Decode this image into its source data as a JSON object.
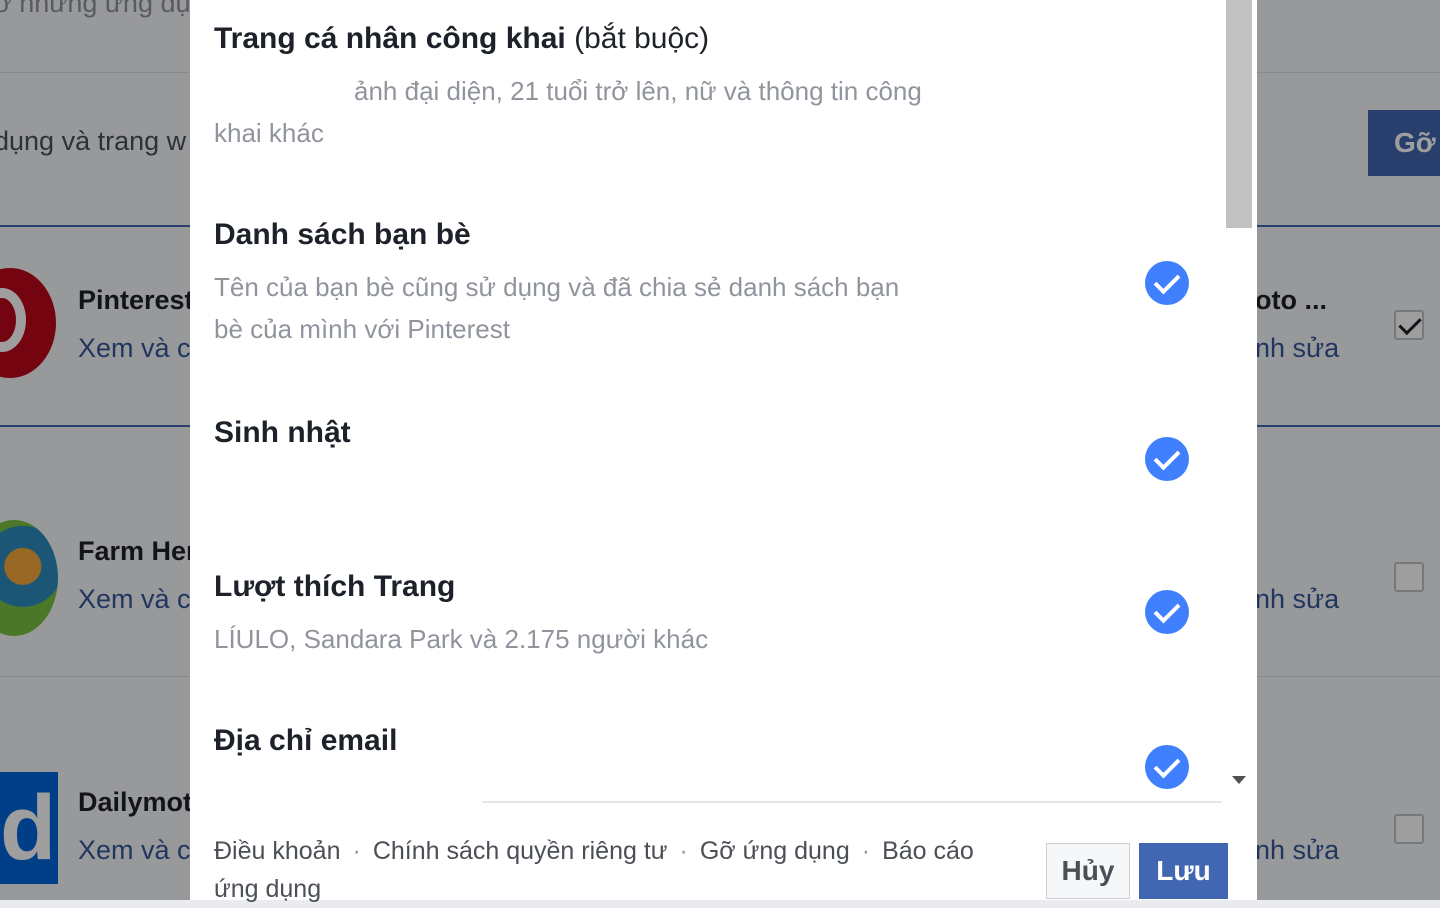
{
  "background": {
    "top_text": "ở những ứng dụ",
    "subheader_text": "dụng và trang w",
    "remove_button_label": "Gỡ",
    "apps": [
      {
        "name": "Pinterest",
        "link": "Xem và ch",
        "right_name": "oto ...",
        "right_link": "nh sửa"
      },
      {
        "name": "Farm Her",
        "link": "Xem và ch",
        "right_link": "nh sửa"
      },
      {
        "name": "Dailymoti",
        "link": "Xem và ch",
        "right_link": "nh sửa"
      }
    ],
    "dailymotion_letter": "d"
  },
  "dialog": {
    "permissions": [
      {
        "title": "Trang cá nhân công khai",
        "title_suffix": "(bắt buộc)",
        "description": "ảnh đại diện, 21 tuổi trở lên, nữ và thông tin công khai khác",
        "checked": true
      },
      {
        "title": "Danh sách bạn bè",
        "description": "Tên của bạn bè cũng sử dụng và đã chia sẻ danh sách bạn bè của mình với Pinterest",
        "checked": true
      },
      {
        "title": "Sinh nhật",
        "checked": true
      },
      {
        "title": "Lượt thích Trang",
        "description": "LÍULO, Sandara Park và 2.175 người khác",
        "checked": true
      },
      {
        "title": "Địa chỉ email",
        "checked": true
      }
    ],
    "footer": {
      "terms": "Điều khoản",
      "privacy": "Chính sách quyền riêng tư",
      "remove_app": "Gỡ ứng dụng",
      "report_app": "Báo cáo ứng dụng",
      "separator": "·"
    },
    "cancel_label": "Hủy",
    "save_label": "Lưu"
  },
  "colors": {
    "brand_blue": "#4267b2",
    "check_blue": "#4080ff",
    "muted_text": "#90949c"
  }
}
